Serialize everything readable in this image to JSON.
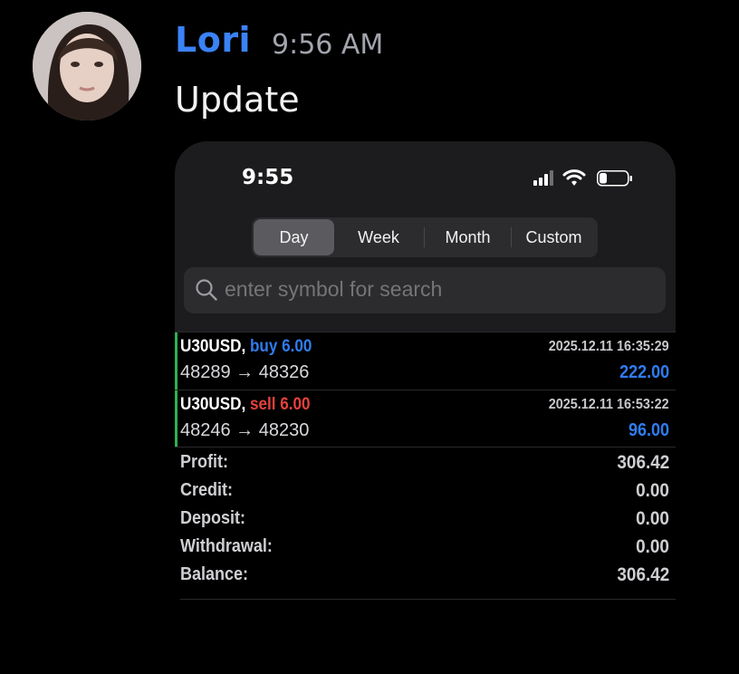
{
  "message": {
    "author": "Lori",
    "time": "9:56 AM",
    "text": "Update"
  },
  "phone": {
    "clock": "9:55",
    "status_icons": [
      "signal-icon",
      "wifi-icon",
      "battery-icon"
    ],
    "tabs": [
      {
        "label": "Day",
        "active": true
      },
      {
        "label": "Week",
        "active": false
      },
      {
        "label": "Month",
        "active": false
      },
      {
        "label": "Custom",
        "active": false
      }
    ],
    "search": {
      "placeholder": "enter symbol for search"
    },
    "trades": [
      {
        "symbol": "U30USD,",
        "side": "buy 6.00",
        "datetime": "2025.12.11 16:35:29",
        "prices": "48289 → 48326",
        "profit": "222.00"
      },
      {
        "symbol": "U30USD,",
        "side": "sell 6.00",
        "datetime": "2025.12.11 16:53:22",
        "prices": "48246 → 48230",
        "profit": "96.00"
      }
    ],
    "summary": [
      {
        "label": "Profit:",
        "value": "306.42"
      },
      {
        "label": "Credit:",
        "value": "0.00"
      },
      {
        "label": "Deposit:",
        "value": "0.00"
      },
      {
        "label": "Withdrawal:",
        "value": "0.00"
      },
      {
        "label": "Balance:",
        "value": "306.42"
      }
    ]
  },
  "colors": {
    "author": "#3a82f6",
    "buy": "#2f7cf0",
    "sell": "#e5413b",
    "position_bar": "#2fb14d"
  }
}
